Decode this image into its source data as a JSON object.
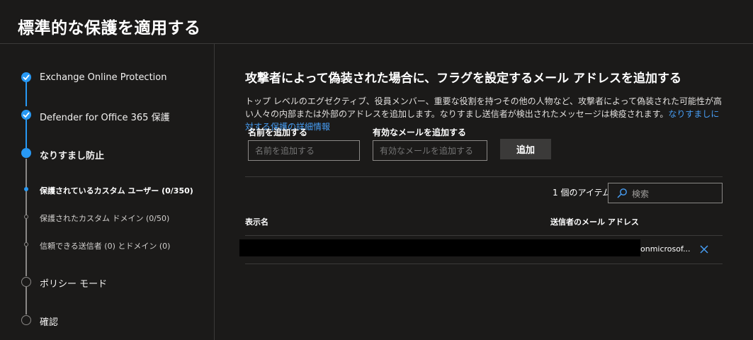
{
  "page_title": "標準的な保護を適用する",
  "stepper": {
    "steps": [
      {
        "label": "Exchange Online Protection",
        "state": "completed"
      },
      {
        "label": "Defender for Office 365 保護",
        "state": "completed"
      },
      {
        "label": "なりすまし防止",
        "state": "current"
      },
      {
        "label": "ポリシー モード",
        "state": "pending"
      },
      {
        "label": "確認",
        "state": "pending"
      }
    ],
    "substeps": [
      {
        "label": "保護されているカスタム ユーザー (0/350)",
        "state": "current"
      },
      {
        "label": "保護されたカスタム ドメイン (0/50)",
        "state": "pending"
      },
      {
        "label": "信頼できる送信者 (0) とドメイン (0)",
        "state": "pending"
      }
    ]
  },
  "main": {
    "heading": "攻撃者によって偽装された場合に、フラグを設定するメール アドレスを追加する",
    "description": "トップ レベルのエグゼクティブ、役員メンバー、重要な役割を持つその他の人物など、攻撃者によって偽装された可能性が高い人々の内部または外部のアドレスを追加します。なりすまし送信者が検出されたメッセージは検疫されます。",
    "description_link": "なりすましに対する保護の詳細情報",
    "name_field": {
      "label": "名前を追加する",
      "placeholder": "名前を追加する",
      "value": ""
    },
    "email_field": {
      "label": "有効なメールを追加する",
      "placeholder": "有効なメールを追加する",
      "value": ""
    },
    "add_button": "追加",
    "item_count": "1 個のアイテム",
    "search": {
      "placeholder": "検索"
    },
    "table": {
      "columns": [
        "表示名",
        "送信者のメール アドレス"
      ],
      "rows": [
        {
          "display_name": "",
          "email_visible": "onmicrosof..."
        }
      ]
    }
  },
  "colors": {
    "background": "#1b1a19",
    "accent": "#2899f5",
    "link": "#479ef5",
    "divider": "#3b3a39",
    "inactive": "#8a8886"
  },
  "icons": [
    "check-icon",
    "search-icon",
    "close-icon"
  ]
}
